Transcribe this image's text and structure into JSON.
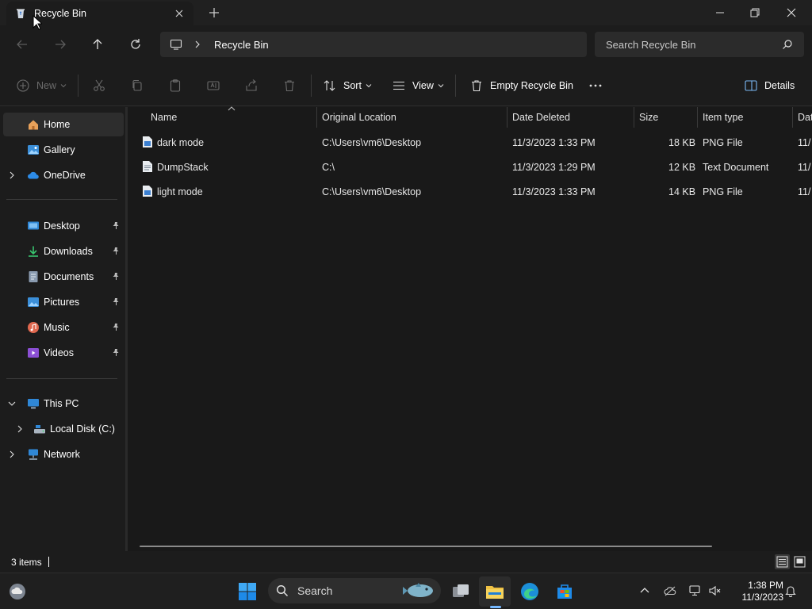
{
  "window": {
    "tab_title": "Recycle Bin"
  },
  "navbar": {
    "breadcrumb": "Recycle Bin",
    "search_placeholder": "Search Recycle Bin"
  },
  "commands": {
    "new": "New",
    "sort": "Sort",
    "view": "View",
    "empty_recycle_bin": "Empty Recycle Bin",
    "details": "Details"
  },
  "sidebar": {
    "home": "Home",
    "gallery": "Gallery",
    "onedrive": "OneDrive",
    "quick_access": [
      {
        "label": "Desktop",
        "icon": "desktop-icon"
      },
      {
        "label": "Downloads",
        "icon": "downloads-icon"
      },
      {
        "label": "Documents",
        "icon": "documents-icon"
      },
      {
        "label": "Pictures",
        "icon": "pictures-icon"
      },
      {
        "label": "Music",
        "icon": "music-icon"
      },
      {
        "label": "Videos",
        "icon": "videos-icon"
      }
    ],
    "this_pc": "This PC",
    "local_disk": "Local Disk (C:)",
    "network": "Network"
  },
  "columns": {
    "name": "Name",
    "original_location": "Original Location",
    "date_deleted": "Date Deleted",
    "size": "Size",
    "item_type": "Item type",
    "date_modified_partial": "Dat"
  },
  "files": [
    {
      "name": "dark mode",
      "location": "C:\\Users\\vm6\\Desktop",
      "deleted": "11/3/2023 1:33 PM",
      "size": "18 KB",
      "type": "PNG File",
      "extra": "11/"
    },
    {
      "name": "DumpStack",
      "location": "C:\\",
      "deleted": "11/3/2023 1:29 PM",
      "size": "12 KB",
      "type": "Text Document",
      "extra": "11/"
    },
    {
      "name": "light mode",
      "location": "C:\\Users\\vm6\\Desktop",
      "deleted": "11/3/2023 1:33 PM",
      "size": "14 KB",
      "type": "PNG File",
      "extra": "11/"
    }
  ],
  "status": {
    "item_count": "3 items"
  },
  "taskbar": {
    "search_label": "Search",
    "time": "1:38 PM",
    "date": "11/3/2023"
  },
  "colors": {
    "accent": "#0078d4",
    "folder": "#f0c244"
  }
}
